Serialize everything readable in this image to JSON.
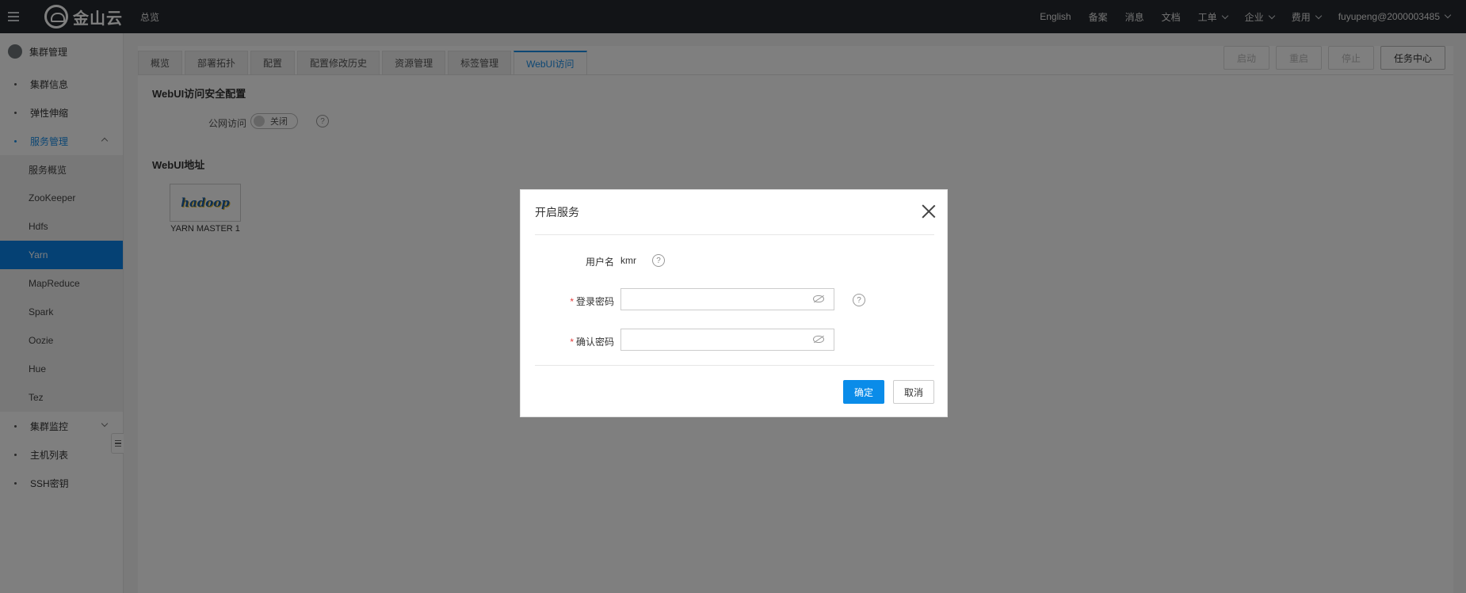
{
  "header": {
    "brand": "金山云",
    "overview": "总览",
    "nav": [
      "English",
      "备案",
      "消息",
      "文档"
    ],
    "nav_dropdowns": [
      "工单",
      "企业",
      "费用",
      "fuyupeng@2000003485"
    ]
  },
  "sidebar": {
    "title": "集群管理",
    "items": [
      "集群信息",
      "弹性伸缩",
      "服务管理"
    ],
    "sub_items": [
      "服务概览",
      "ZooKeeper",
      "Hdfs",
      "Yarn",
      "MapReduce",
      "Spark",
      "Oozie",
      "Hue",
      "Tez"
    ],
    "items_after": [
      "集群监控",
      "主机列表",
      "SSH密钥"
    ]
  },
  "tabs": [
    "概览",
    "部署拓扑",
    "配置",
    "配置修改历史",
    "资源管理",
    "标签管理",
    "WebUI访问"
  ],
  "actions": [
    "启动",
    "重启",
    "停止",
    "任务中心"
  ],
  "security": {
    "title": "WebUI访问安全配置",
    "public_label": "公网访问",
    "toggle_text": "关闭",
    "help": "?"
  },
  "webui": {
    "title": "WebUI地址",
    "logo_text": "hadoop",
    "caption": "YARN MASTER 1"
  },
  "modal": {
    "title": "开启服务",
    "username_label": "用户名",
    "username_value": "kmr",
    "password_label": "登录密码",
    "confirm_label": "确认密码",
    "required_mark": "*",
    "password_value": "",
    "confirm_value": "",
    "ok": "确定",
    "cancel": "取消",
    "help": "?"
  },
  "colors": {
    "accent": "#0a83e8",
    "topbar": "#25292e",
    "required": "#e23d3d"
  }
}
